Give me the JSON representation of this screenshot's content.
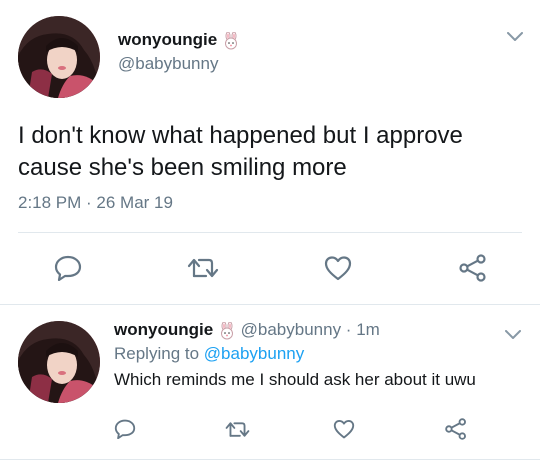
{
  "main_tweet": {
    "display_name": "wonyoungie",
    "name_emoji": "bunny-face-icon",
    "handle": "@babybunny",
    "text_line1": "I don't know what happened but I approve",
    "text_line2": "cause she's been smiling more",
    "timestamp": "2:18 PM · 26 Mar 19"
  },
  "reply_tweet": {
    "display_name": "wonyoungie",
    "name_emoji": "bunny-face-icon",
    "handle_time": "@babybunny · 1m",
    "replying_prefix": "Replying to",
    "replying_to": "@babybunny",
    "text": "Which reminds me I should ask her about it uwu"
  },
  "actions": [
    "reply-icon",
    "retweet-icon",
    "like-icon",
    "share-icon"
  ],
  "colors": {
    "text": "#14171a",
    "muted": "#657786",
    "link": "#1da1f2",
    "divider": "#e1e8ed",
    "icon": "#657786"
  }
}
